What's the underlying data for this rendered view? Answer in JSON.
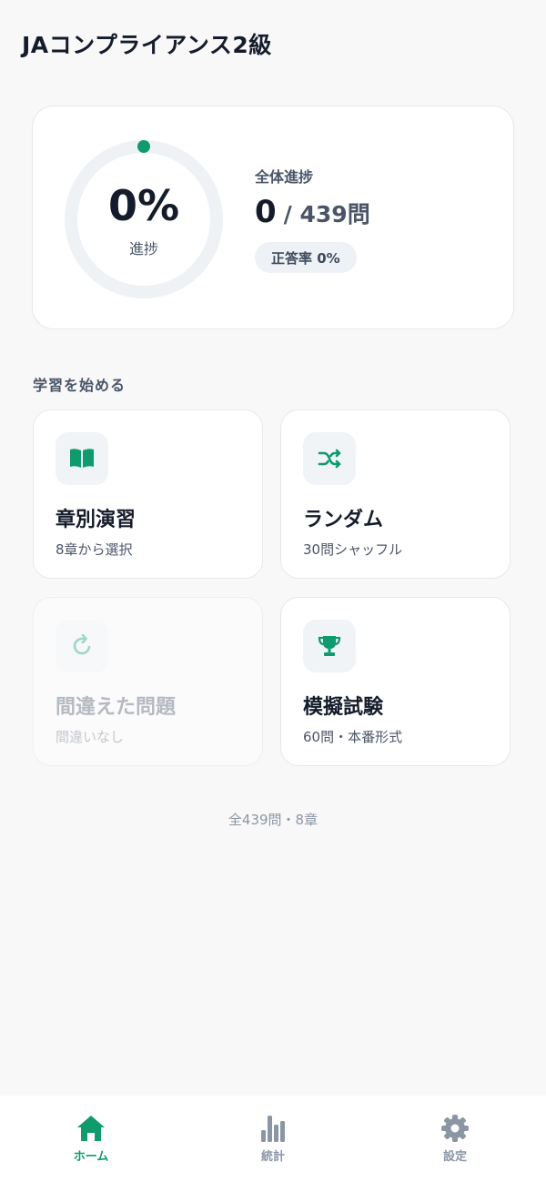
{
  "app": {
    "title": "JAコンプライアンス2級"
  },
  "progress": {
    "percent_text": "0%",
    "percent_label": "進捗",
    "overall_label": "全体進捗",
    "answered": "0",
    "total_text": "/ 439問",
    "accuracy_text": "正答率 0%",
    "fraction": 0
  },
  "section": {
    "title": "学習を始める"
  },
  "modes": [
    {
      "title": "章別演習",
      "subtitle": "8章から選択",
      "icon": "book-icon",
      "enabled": true
    },
    {
      "title": "ランダム",
      "subtitle": "30問シャッフル",
      "icon": "shuffle-icon",
      "enabled": true
    },
    {
      "title": "間違えた問題",
      "subtitle": "間違いなし",
      "icon": "refresh-icon",
      "enabled": false
    },
    {
      "title": "模擬試験",
      "subtitle": "60問・本番形式",
      "icon": "trophy-icon",
      "enabled": true
    }
  ],
  "footer": {
    "note": "全439問・8章"
  },
  "tabs": [
    {
      "label": "ホーム",
      "icon": "home-icon",
      "active": true
    },
    {
      "label": "統計",
      "icon": "bar-chart-icon",
      "active": false
    },
    {
      "label": "設定",
      "icon": "gear-icon",
      "active": false
    }
  ],
  "colors": {
    "accent": "#0f9b6c",
    "inactive": "#8b96a5",
    "text": "#141c2b"
  }
}
